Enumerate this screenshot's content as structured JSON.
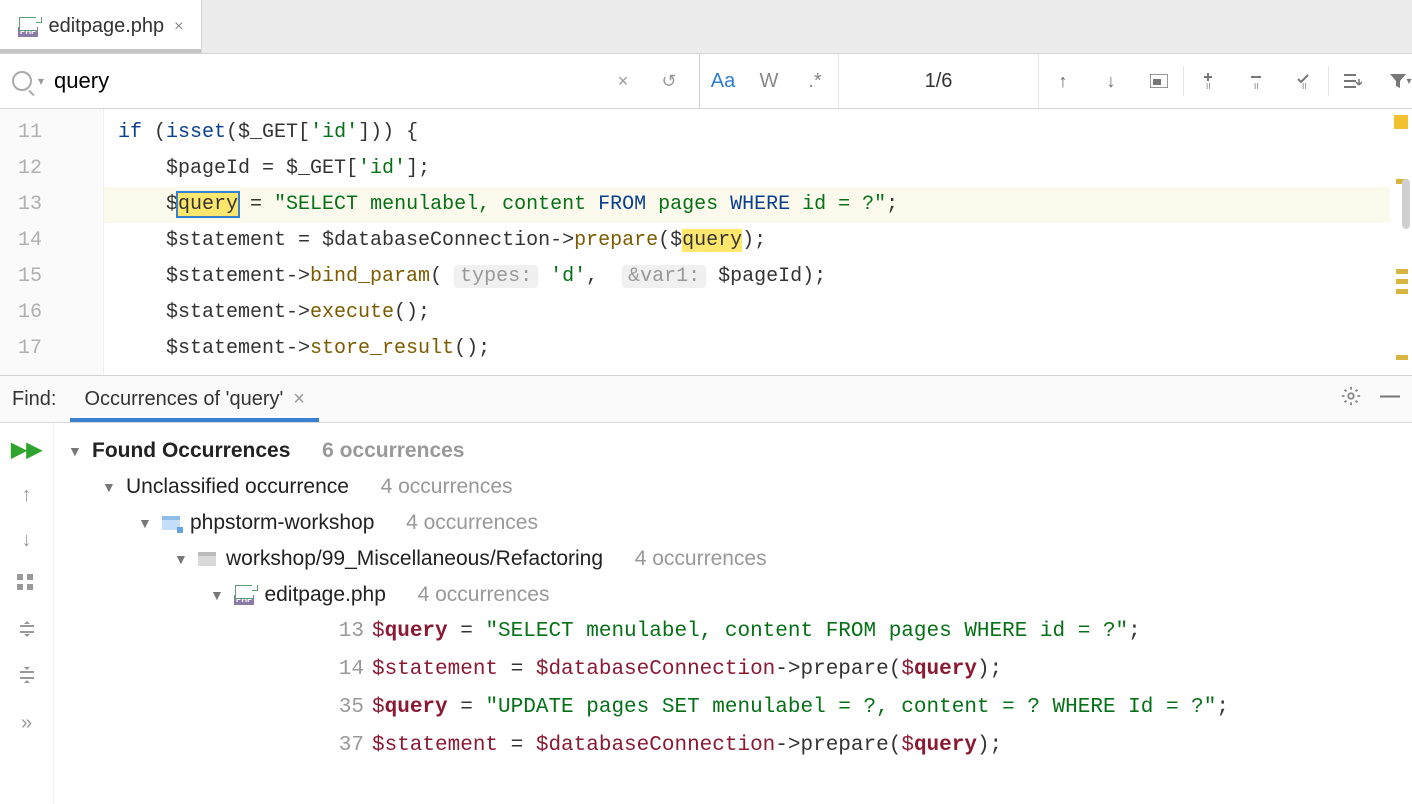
{
  "tab": {
    "name": "editpage.php"
  },
  "search": {
    "query": "query",
    "count": "1/6",
    "match_case_active": true
  },
  "editor": {
    "lines": [
      {
        "num": "11",
        "i": 0,
        "raw": "if (isset($_GET['id'])) {"
      },
      {
        "num": "12",
        "i": 1,
        "raw": "    $pageId = $_GET['id'];"
      },
      {
        "num": "13",
        "i": 1,
        "raw": "    $query = \"SELECT menulabel, content FROM pages WHERE id = ?\";",
        "hl": true
      },
      {
        "num": "14",
        "i": 1,
        "raw": "    $statement = $databaseConnection->prepare($query);"
      },
      {
        "num": "15",
        "i": 1,
        "raw": "    $statement->bind_param( types: 'd', &var1: $pageId);"
      },
      {
        "num": "16",
        "i": 1,
        "raw": "    $statement->execute();"
      },
      {
        "num": "17",
        "i": 1,
        "raw": "    $statement->store_result();"
      }
    ]
  },
  "find": {
    "header_label": "Find:",
    "tab_title": "Occurrences of 'query'",
    "summary_title": "Found Occurrences",
    "summary_count": "6 occurrences",
    "unclassified": {
      "label": "Unclassified occurrence",
      "count": "4 occurrences"
    },
    "project": {
      "name": "phpstorm-workshop",
      "count": "4 occurrences"
    },
    "folder": {
      "name": "workshop/99_Miscellaneous/Refactoring",
      "count": "4 occurrences"
    },
    "file": {
      "name": "editpage.php",
      "count": "4 occurrences"
    },
    "results": [
      {
        "line": "13",
        "pre": "$",
        "hit": "query",
        "post": " = \"SELECT menulabel, content FROM pages WHERE id = ?\";",
        "str": true
      },
      {
        "line": "14",
        "pre": "$statement = $databaseConnection->prepare($",
        "hit": "query",
        "post": ");",
        "str": false
      },
      {
        "line": "35",
        "pre": "$",
        "hit": "query",
        "post": " = \"UPDATE pages SET menulabel = ?, content = ? WHERE Id = ?\";",
        "str": true
      },
      {
        "line": "37",
        "pre": "$statement = $databaseConnection->prepare($",
        "hit": "query",
        "post": ");",
        "str": false
      }
    ]
  }
}
